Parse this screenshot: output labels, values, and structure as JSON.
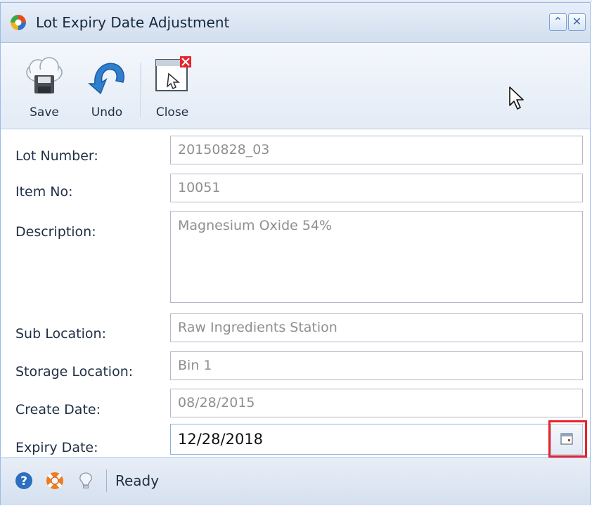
{
  "window": {
    "title": "Lot Expiry Date Adjustment",
    "accent_color": "#99bbe8",
    "restore_icon": "double-chevron-up-icon",
    "close_icon": "close-icon"
  },
  "toolbar": {
    "save_label": "Save",
    "undo_label": "Undo",
    "close_label": "Close"
  },
  "form": {
    "fields": [
      {
        "label": "Lot Number:",
        "value": "20150828_03"
      },
      {
        "label": "Item No:",
        "value": "10051"
      },
      {
        "label": "Description:",
        "value": "Magnesium Oxide 54%"
      },
      {
        "label": "Sub Location:",
        "value": "Raw Ingredients Station"
      },
      {
        "label": "Storage Location:",
        "value": "Bin 1"
      },
      {
        "label": "Create Date:",
        "value": "08/28/2015"
      },
      {
        "label": "Expiry Date:",
        "value": "12/28/2018"
      }
    ],
    "highlight_color": "#e8222b"
  },
  "statusbar": {
    "status": "Ready",
    "icons": [
      "help-icon",
      "lifebuoy-icon",
      "lightbulb-icon"
    ]
  }
}
